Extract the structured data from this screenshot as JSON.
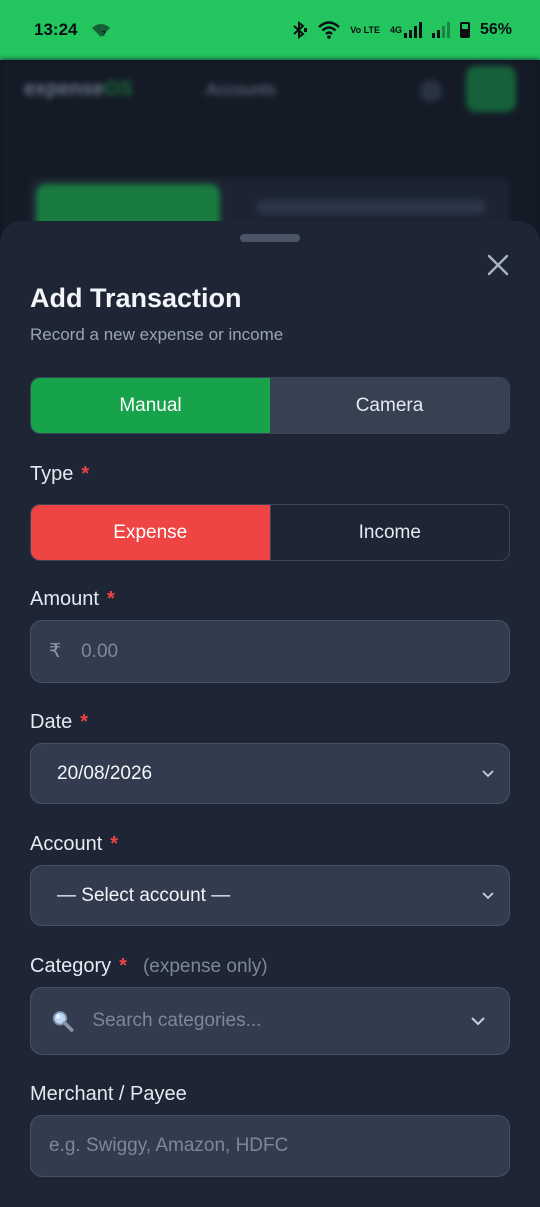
{
  "status_bar": {
    "time": "13:24",
    "network_label": "Vo LTE",
    "net_type": "4G",
    "battery": "56%"
  },
  "background_app": {
    "brand_name": "expense",
    "brand_accent": "OS",
    "nav_label": "Accounts"
  },
  "sheet": {
    "title": "Add Transaction",
    "subtitle": "Record a new expense or income",
    "mode_tabs": [
      {
        "label": "Manual",
        "active": true
      },
      {
        "label": "Camera",
        "active": false
      }
    ],
    "type": {
      "label": "Type",
      "required_mark": "*",
      "options": [
        {
          "label": "Expense",
          "active": true
        },
        {
          "label": "Income",
          "active": false
        }
      ]
    },
    "amount": {
      "label": "Amount",
      "required_mark": "*",
      "currency_symbol": "₹",
      "placeholder": "0.00",
      "value": ""
    },
    "date": {
      "label": "Date",
      "required_mark": "*",
      "value": "20/08/2026"
    },
    "account": {
      "label": "Account",
      "required_mark": "*",
      "selected": "— Select account —"
    },
    "category": {
      "label": "Category",
      "required_mark": "*",
      "hint": "(expense only)",
      "placeholder": "Search categories...",
      "value": ""
    },
    "merchant": {
      "label": "Merchant / Payee",
      "placeholder": "e.g. Swiggy, Amazon, HDFC",
      "value": ""
    }
  },
  "colors": {
    "status_bar": "#22c55e",
    "sheet_bg": "#1e2636",
    "manual_active": "#16a34a",
    "expense_active": "#ef4444",
    "required": "#ef4444"
  }
}
